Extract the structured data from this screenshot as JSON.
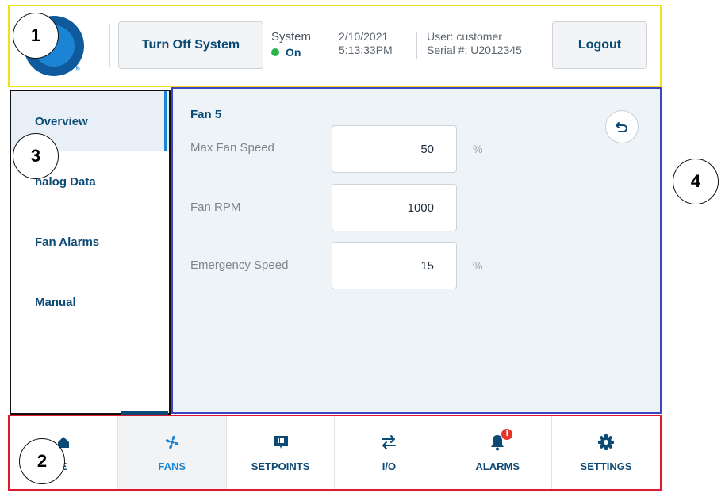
{
  "header": {
    "turn_off_label": "Turn Off System",
    "system_label": "System",
    "system_status": "On",
    "date": "2/10/2021",
    "time": "5:13:33PM",
    "user": "User: customer",
    "serial": "Serial #: U2012345",
    "logout_label": "Logout",
    "logo_mark": "®"
  },
  "sidebar": {
    "items": [
      {
        "label": "Overview",
        "active": true
      },
      {
        "label": "Analog Data",
        "visible_text": "nalog Data"
      },
      {
        "label": "Fan Alarms"
      },
      {
        "label": "Manual"
      }
    ]
  },
  "content": {
    "title": "Fan 5",
    "fields": [
      {
        "label": "Max Fan Speed",
        "value": "50",
        "unit": "%"
      },
      {
        "label": "Fan RPM",
        "value": "1000",
        "unit": ""
      },
      {
        "label": "Emergency Speed",
        "value": "15",
        "unit": "%"
      }
    ],
    "back_icon": "undo-arrow-icon"
  },
  "bottomnav": {
    "tabs": [
      {
        "label": "HOME",
        "visible_text": "E",
        "icon": "home-icon"
      },
      {
        "label": "FANS",
        "icon": "fan-icon",
        "active": true
      },
      {
        "label": "SETPOINTS",
        "icon": "setpoints-icon"
      },
      {
        "label": "I/O",
        "icon": "swap-arrows-icon"
      },
      {
        "label": "ALARMS",
        "icon": "bell-alert-icon",
        "badge": "!"
      },
      {
        "label": "SETTINGS",
        "icon": "gear-icon"
      }
    ]
  },
  "callouts": [
    "1",
    "2",
    "3",
    "4"
  ],
  "colors": {
    "brand_blue": "#0b4a75",
    "accent_blue": "#1c84d4",
    "status_green": "#2bb34a",
    "alarm_red": "#e8352b",
    "region1_border": "#f2de1a",
    "region2_border": "#e0192f",
    "region3_border": "#111111",
    "region4_border": "#3b44c4"
  }
}
